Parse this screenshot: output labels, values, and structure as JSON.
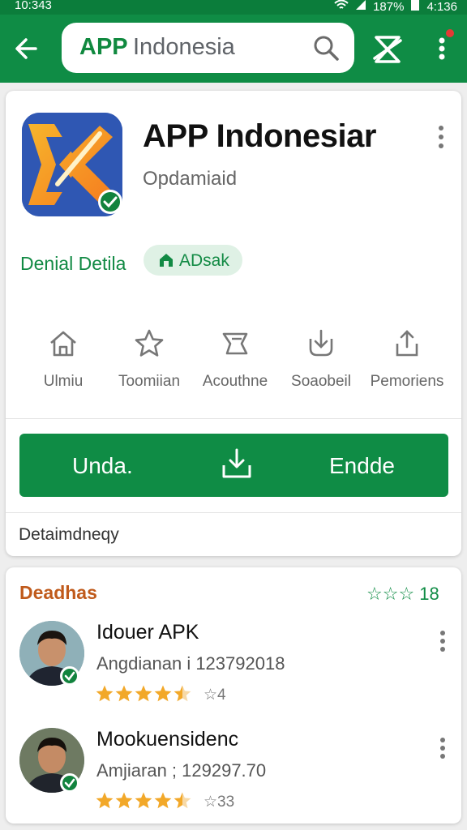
{
  "status_bar": {
    "time_left": "10:343",
    "battery": "187%",
    "time_right": "4:136"
  },
  "search": {
    "logo": "APP",
    "title": "Indonesia"
  },
  "app": {
    "name": "APP Indonesiar",
    "developer": "Opdamiaid",
    "detail_link": "Denial Detila",
    "chip_label": "ADsak",
    "actions": [
      {
        "label": "Ulmiu",
        "icon": "home-icon"
      },
      {
        "label": "Toomiian",
        "icon": "star-icon"
      },
      {
        "label": "Acouthne",
        "icon": "ticket-icon"
      },
      {
        "label": "Soaobeil",
        "icon": "arrow-down-icon"
      },
      {
        "label": "Pemoriens",
        "icon": "share-icon"
      }
    ],
    "install_left": "Unda.",
    "install_right": "Endde",
    "detail_footer": "Detaimdneqy"
  },
  "reviews": {
    "title": "Deadhas",
    "header_rating": "☆☆☆ 18",
    "items": [
      {
        "name": "Idouer APK",
        "meta": "Angdianan i 123792018",
        "stars": 4.5,
        "count": "☆4"
      },
      {
        "name": "Mookuensidenc",
        "meta": "Amjiaran ; 129297.70",
        "stars": 4.5,
        "count": "☆33"
      }
    ]
  },
  "colors": {
    "brand_green": "#0f8c45",
    "accent_orange": "#c05a1b",
    "star_gold": "#f2a829"
  }
}
